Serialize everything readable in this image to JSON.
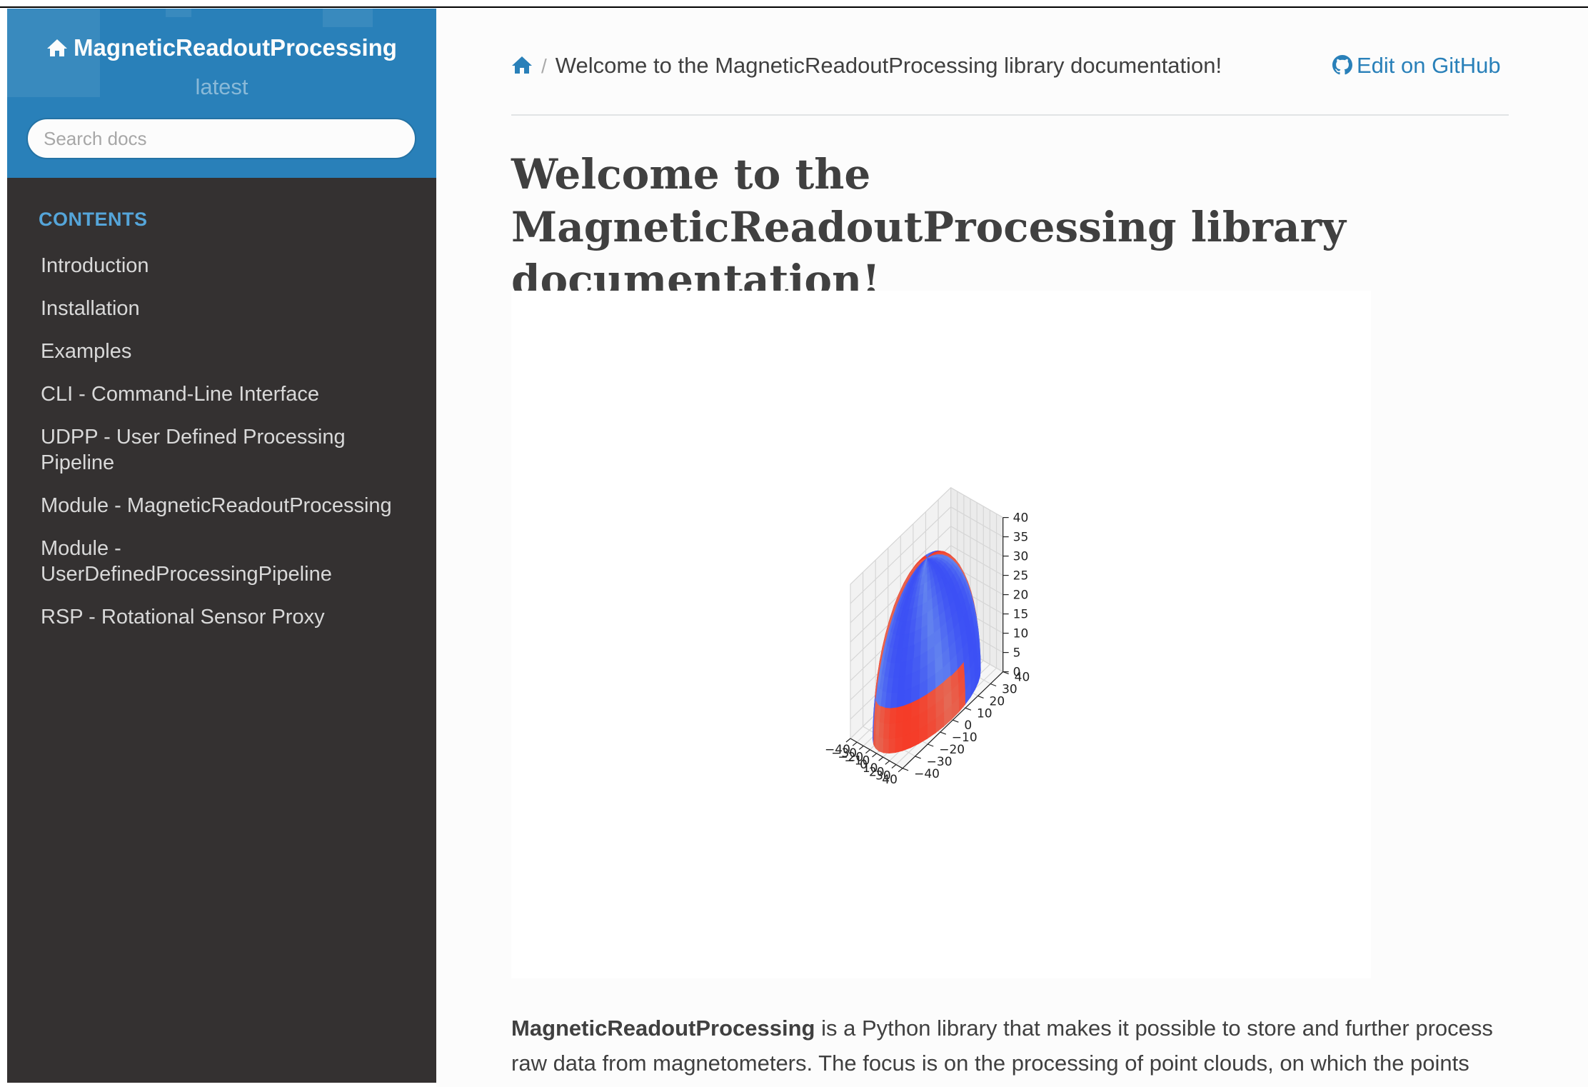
{
  "sidebar": {
    "project_name": "MagneticReadoutProcessing",
    "version": "latest",
    "search_placeholder": "Search docs",
    "caption": "CONTENTS",
    "items": [
      {
        "label": "Introduction"
      },
      {
        "label": "Installation"
      },
      {
        "label": "Examples"
      },
      {
        "label": "CLI - Command-Line Interface"
      },
      {
        "label": "UDPP - User Defined Processing Pipeline"
      },
      {
        "label": "Module - MagneticReadoutProcessing"
      },
      {
        "label": "Module - UserDefinedProcessingPipeline"
      },
      {
        "label": "RSP - Rotational Sensor Proxy"
      }
    ]
  },
  "breadcrumb": {
    "home_icon": "home-icon",
    "current": "Welcome to the MagneticReadoutProcessing library documentation!"
  },
  "edit_link": {
    "icon": "github-icon",
    "label": "Edit on GitHub"
  },
  "page": {
    "title": "Welcome to the MagneticReadoutProcessing library documentation!",
    "intro_bold": "MagneticReadoutProcessing",
    "intro_rest": " is a Python library that makes it possible to store and further process raw data from magnetometers. The focus is on the processing of point clouds, on which the points"
  },
  "colors": {
    "sidebar_header": "#2980b9",
    "sidebar_bg": "#343131",
    "link": "#2980b9",
    "caption": "#55a5d9"
  },
  "chart_data": {
    "type": "3d-surface",
    "description_free": true,
    "x_ticks": [
      "−40",
      "−30",
      "−20",
      "−10",
      "0",
      "10",
      "20",
      "30",
      "40"
    ],
    "y_ticks": [
      "−40",
      "−30",
      "−20",
      "−10",
      "0",
      "10",
      "20",
      "30",
      "40"
    ],
    "z_ticks": [
      "0",
      "5",
      "10",
      "15",
      "20",
      "25",
      "30",
      "35",
      "40"
    ],
    "xlim": [
      -40,
      40
    ],
    "ylim": [
      -40,
      40
    ],
    "zlim": [
      0,
      40
    ],
    "colormap": "coolwarm",
    "grid": true
  }
}
